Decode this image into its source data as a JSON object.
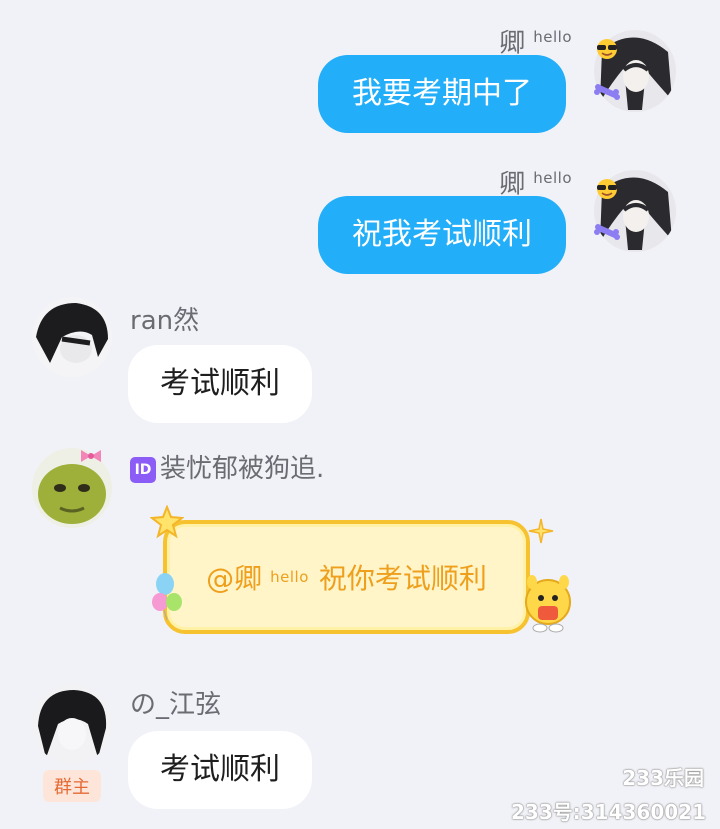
{
  "colors": {
    "background": "#f1f2f7",
    "my_bubble": "#22aef8",
    "other_bubble": "#ffffff",
    "special_border": "#f7c230",
    "special_text": "#ee9f1c",
    "owner_badge_bg": "#fde6d9",
    "owner_badge_text": "#e56a36"
  },
  "messages": [
    {
      "sender": "卿",
      "sender_tag": "hello",
      "text": "我要考期中了",
      "side": "right"
    },
    {
      "sender": "卿",
      "sender_tag": "hello",
      "text": "祝我考试顺利",
      "side": "right"
    },
    {
      "sender": "ran然",
      "text": "考试顺利",
      "side": "left"
    },
    {
      "sender_id_icon": "ID",
      "sender": "装忧郁被狗追.",
      "mention": "@卿",
      "mention_tag": "hello",
      "text": "祝你考试顺利",
      "side": "left",
      "bubble_style": "special-yellow"
    },
    {
      "sender": "の_江弦",
      "badge": "群主",
      "text": "考试顺利",
      "side": "left"
    }
  ],
  "watermark": {
    "logo": "233乐园",
    "account": "233号:314360021"
  }
}
